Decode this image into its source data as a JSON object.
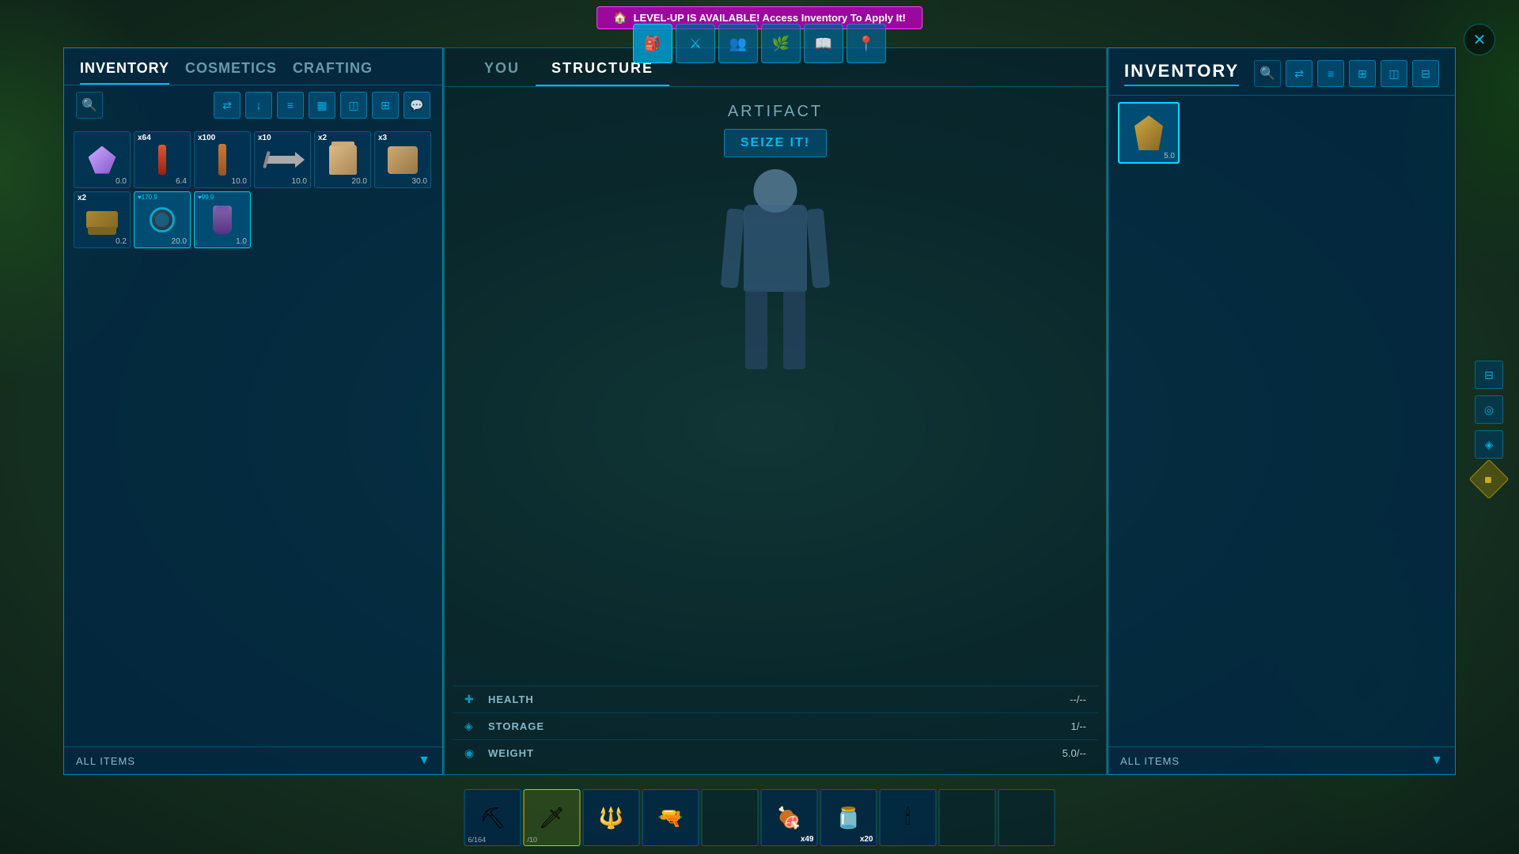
{
  "notification": {
    "icon": "🏠",
    "text": "LEVEL-UP IS AVAILABLE! Access Inventory To Apply It!"
  },
  "top_nav": {
    "buttons": [
      {
        "id": "inventory",
        "icon": "🎒",
        "active": true
      },
      {
        "id": "character",
        "icon": "⚔",
        "active": false
      },
      {
        "id": "tribe",
        "icon": "👥",
        "active": false
      },
      {
        "id": "crafting",
        "icon": "🌿",
        "active": false
      },
      {
        "id": "map",
        "icon": "📖",
        "active": false
      },
      {
        "id": "location",
        "icon": "📍",
        "active": false
      }
    ]
  },
  "close_label": "✕",
  "left_panel": {
    "tabs": [
      {
        "label": "INVENTORY",
        "active": true
      },
      {
        "label": "COSMETICS",
        "active": false
      },
      {
        "label": "CRAFTING",
        "active": false
      }
    ],
    "toolbar_buttons": [
      "⇄",
      "↓",
      "≡",
      "▦",
      "◫",
      "⊞",
      "💬"
    ],
    "items": [
      {
        "qty": null,
        "value": "0.0",
        "type": "crystal",
        "selected": false
      },
      {
        "qty": "x64",
        "value": "6.4",
        "type": "red_stick",
        "selected": false
      },
      {
        "qty": "x100",
        "value": "10.0",
        "type": "orange_stick",
        "selected": false
      },
      {
        "qty": "x10",
        "value": "10.0",
        "type": "arrow",
        "selected": false
      },
      {
        "qty": "x2",
        "value": "20.0",
        "type": "roll",
        "selected": false
      },
      {
        "qty": "x3",
        "value": "30.0",
        "type": "roll2",
        "selected": false
      },
      {
        "qty": "x2",
        "value": "0.2",
        "type": "comb",
        "selected": false
      },
      {
        "qty": "♥170.9",
        "value": "20.0",
        "type": "gear",
        "selected": true
      },
      {
        "qty": "♥99.9",
        "value": "1.0",
        "type": "flask",
        "selected": true
      }
    ],
    "filter": "ALL ITEMS"
  },
  "middle_panel": {
    "tabs": [
      {
        "label": "YOU",
        "active": false
      },
      {
        "label": "STRUCTURE",
        "active": true
      }
    ],
    "structure_title": "ARTIFACT",
    "seize_label": "SEIZE IT!",
    "stats": [
      {
        "icon": "+",
        "name": "HEALTH",
        "value": "--/--"
      },
      {
        "icon": "◈",
        "name": "STORAGE",
        "value": "1/--"
      },
      {
        "icon": "◉",
        "name": "WEIGHT",
        "value": "5.0/--"
      }
    ]
  },
  "right_panel": {
    "title": "INVENTORY",
    "toolbar_buttons": [
      "⇄",
      "≡",
      "⊞",
      "◫",
      "⊟"
    ],
    "items": [
      {
        "qty": null,
        "value": "5.0",
        "type": "artifact_item",
        "selected": true
      }
    ],
    "filter": "ALL ITEMS"
  },
  "hotbar": {
    "slots": [
      {
        "type": "pickaxe",
        "icon": "⛏",
        "qty": null,
        "val": "6/164",
        "active": false
      },
      {
        "type": "sword",
        "icon": "🗡",
        "qty": null,
        "val": "/10",
        "active": true
      },
      {
        "type": "staff",
        "icon": "𝄙",
        "qty": null,
        "val": null,
        "active": false
      },
      {
        "type": "gun",
        "icon": "🔫",
        "qty": null,
        "val": null,
        "active": false
      },
      {
        "type": "empty",
        "icon": null,
        "qty": null,
        "val": null,
        "active": false
      },
      {
        "type": "meat",
        "icon": "🍖",
        "qty": "x49",
        "val": null,
        "active": false
      },
      {
        "type": "pot",
        "icon": "🫙",
        "qty": "x20",
        "val": null,
        "active": false
      },
      {
        "type": "candle",
        "icon": "🕯",
        "qty": null,
        "val": null,
        "active": false
      },
      {
        "type": "empty",
        "icon": null,
        "qty": null,
        "val": null,
        "active": false
      },
      {
        "type": "empty",
        "icon": null,
        "qty": null,
        "val": null,
        "active": false
      }
    ]
  },
  "right_side_icons": [
    {
      "id": "icon1",
      "symbol": "⊟"
    },
    {
      "id": "icon2",
      "symbol": "◎"
    },
    {
      "id": "icon3",
      "symbol": "◈"
    },
    {
      "id": "diamond",
      "symbol": "◆",
      "is_diamond": true
    }
  ]
}
